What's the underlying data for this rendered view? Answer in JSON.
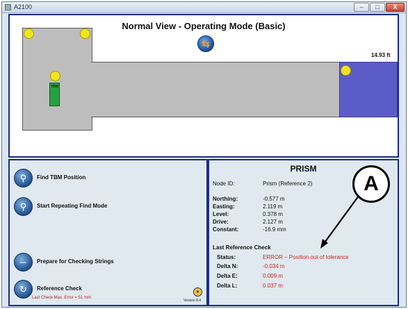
{
  "window": {
    "title": "A2100",
    "min_label": "–",
    "max_label": "□",
    "close_label": "X"
  },
  "view": {
    "title": "Normal View - Operating Mode (Basic)",
    "distance": "14.93 ft",
    "tbm_label": "TBM",
    "nav_icon": "swap-arrows-icon"
  },
  "actions": [
    {
      "label": "Find TBM Position",
      "icon": "search-icon"
    },
    {
      "label": "Start Repeating Find Mode",
      "icon": "search-icon"
    },
    {
      "label": "Prepare for Checking Strings",
      "icon": "string-line-icon"
    },
    {
      "label": "Reference Check",
      "sublabel": "Last Check Max. Error = 51 mm",
      "icon": "reference-check-icon"
    }
  ],
  "version": "Version 8.4",
  "prism": {
    "title": "PRISM",
    "node_id_label": "Node ID:",
    "node_id_value": "Prism  (Reference 2)",
    "rows": [
      {
        "label": "Northing:",
        "value": "-0.577 m"
      },
      {
        "label": "Easting:",
        "value": "2.119 m"
      },
      {
        "label": "Level:",
        "value": "0.378 m"
      },
      {
        "label": "Drive:",
        "value": "2.127 m"
      },
      {
        "label": "Constant:",
        "value": "-16.9 mm"
      }
    ],
    "last_ref_label": "Last Reference Check",
    "check": [
      {
        "label": "Status:",
        "value": "ERROR – Position out of tolerance"
      },
      {
        "label": "Delta N:",
        "value": "-0.034 m"
      },
      {
        "label": "Delta E:",
        "value": "0.009 m"
      },
      {
        "label": "Delta L:",
        "value": "0.037 m"
      }
    ]
  },
  "callout": "A",
  "colors": {
    "frame": "#1c2b86",
    "error": "#d2231b",
    "tbm": "#26a045",
    "target": "#5c5cc8"
  }
}
